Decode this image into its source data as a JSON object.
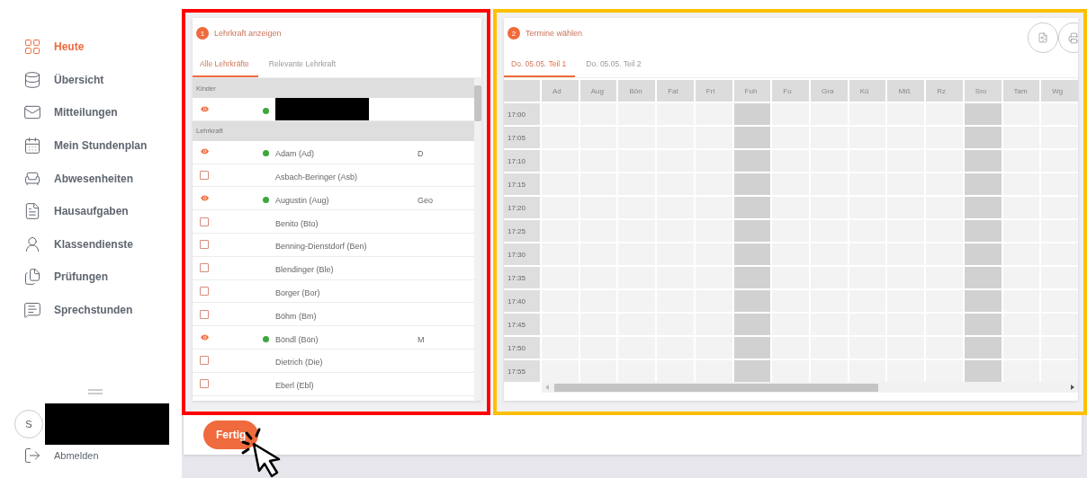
{
  "sidebar": {
    "items": [
      {
        "label": "Heute",
        "selected": true
      },
      {
        "label": "Übersicht",
        "selected": false
      },
      {
        "label": "Mitteilungen",
        "selected": false
      },
      {
        "label": "Mein Stundenplan",
        "selected": false
      },
      {
        "label": "Abwesenheiten",
        "selected": false
      },
      {
        "label": "Hausaufgaben",
        "selected": false
      },
      {
        "label": "Klassendienste",
        "selected": false
      },
      {
        "label": "Prüfungen",
        "selected": false
      },
      {
        "label": "Sprechstunden",
        "selected": false
      }
    ],
    "user": {
      "initial": "S",
      "redacted": true
    },
    "logout": "Abmelden"
  },
  "teacher_panel": {
    "step": "1",
    "title": "Lehrkraft anzeigen",
    "tabs": [
      {
        "label": "Alle Lehrkräfte",
        "selected": true
      },
      {
        "label": "Relevante Lehrkraft",
        "selected": false
      }
    ],
    "groups": [
      {
        "label": "Kinder",
        "rows": [
          {
            "visible": true,
            "redacted": true
          }
        ]
      },
      {
        "label": "Lehrkraft",
        "rows": [
          {
            "name": "Adam (Ad)",
            "subject": "D",
            "visible": true
          },
          {
            "name": "Asbach-Beringer (Asb)",
            "visible": false
          },
          {
            "name": "Augustin (Aug)",
            "subject": "Geo",
            "visible": true
          },
          {
            "name": "Benito (Bto)",
            "visible": false
          },
          {
            "name": "Benning-Dienstdorf (Ben)",
            "visible": false
          },
          {
            "name": "Blendinger (Ble)",
            "visible": false
          },
          {
            "name": "Borger (Bor)",
            "visible": false
          },
          {
            "name": "Böhm (Bm)",
            "visible": false
          },
          {
            "name": "Böndl (Bön)",
            "subject": "M",
            "visible": true
          },
          {
            "name": "Dietrich (Die)",
            "visible": false
          },
          {
            "name": "Eberl (Ebl)",
            "visible": false
          }
        ]
      }
    ]
  },
  "schedule_panel": {
    "step": "2",
    "title": "Termine wählen",
    "tabs": [
      {
        "date": "Do. 05.05.",
        "part": "Teil 1",
        "selected": true
      },
      {
        "date": "Do. 05.05.",
        "part": "Teil 2",
        "selected": false
      }
    ],
    "columns": [
      {
        "label": "Ad",
        "blocked": false
      },
      {
        "label": "Aug",
        "blocked": false
      },
      {
        "label": "Bön",
        "blocked": false
      },
      {
        "label": "Fat",
        "blocked": false
      },
      {
        "label": "Fri",
        "blocked": false
      },
      {
        "label": "Fuh",
        "blocked": true
      },
      {
        "label": "Fu",
        "blocked": false
      },
      {
        "label": "Gra",
        "blocked": false
      },
      {
        "label": "Kü",
        "blocked": false
      },
      {
        "label": "Miß",
        "blocked": false
      },
      {
        "label": "Rz",
        "blocked": false
      },
      {
        "label": "Sro",
        "blocked": true
      },
      {
        "label": "Tam",
        "blocked": false
      },
      {
        "label": "Wg",
        "blocked": false
      }
    ],
    "times": [
      "17:00",
      "17:05",
      "17:10",
      "17:15",
      "17:20",
      "17:25",
      "17:30",
      "17:35",
      "17:40",
      "17:45",
      "17:50",
      "17:55"
    ]
  },
  "done_button": "Fertig"
}
